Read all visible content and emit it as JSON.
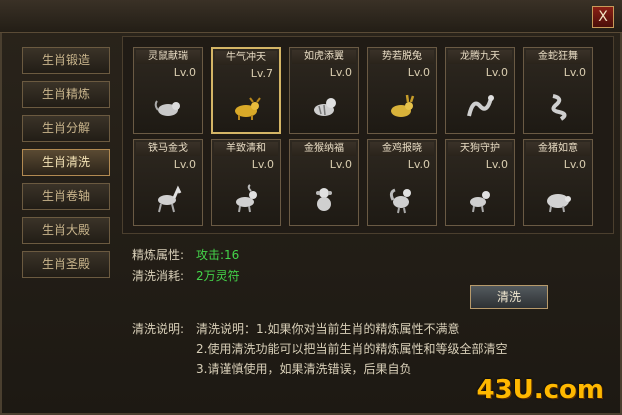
{
  "window": {
    "close_label": "X"
  },
  "sidebar": {
    "items": [
      {
        "label": "生肖锻造"
      },
      {
        "label": "生肖精炼"
      },
      {
        "label": "生肖分解"
      },
      {
        "label": "生肖清洗",
        "active": true
      },
      {
        "label": "生肖卷轴"
      },
      {
        "label": "生肖大殿"
      },
      {
        "label": "生肖圣殿"
      }
    ]
  },
  "zodiac": [
    {
      "name": "灵鼠献瑞",
      "level": "Lv.0",
      "icon": "rat-icon"
    },
    {
      "name": "牛气冲天",
      "level": "Lv.7",
      "icon": "ox-icon",
      "selected": true
    },
    {
      "name": "如虎添翼",
      "level": "Lv.0",
      "icon": "tiger-icon"
    },
    {
      "name": "势若脱兔",
      "level": "Lv.0",
      "icon": "rabbit-icon"
    },
    {
      "name": "龙腾九天",
      "level": "Lv.0",
      "icon": "dragon-icon"
    },
    {
      "name": "金蛇狂舞",
      "level": "Lv.0",
      "icon": "snake-icon"
    },
    {
      "name": "铁马金戈",
      "level": "Lv.0",
      "icon": "horse-icon"
    },
    {
      "name": "羊致清和",
      "level": "Lv.0",
      "icon": "goat-icon"
    },
    {
      "name": "金猴纳福",
      "level": "Lv.0",
      "icon": "monkey-icon"
    },
    {
      "name": "金鸡报晓",
      "level": "Lv.0",
      "icon": "rooster-icon"
    },
    {
      "name": "天狗守护",
      "level": "Lv.0",
      "icon": "dog-icon"
    },
    {
      "name": "金猪如意",
      "level": "Lv.0",
      "icon": "pig-icon"
    }
  ],
  "refine": {
    "attr_label": "精炼属性:",
    "attr_value": "攻击:16",
    "cost_label": "清洗消耗:",
    "cost_value": "2万灵符"
  },
  "wash_button": "清洗",
  "description": {
    "label": "清洗说明:",
    "line1": "清洗说明：1.如果你对当前生肖的精炼属性不满意",
    "line2": "2.使用清洗功能可以把当前生肖的精炼属性和等级全部清空",
    "line3": "3.请谨慎使用，如果清洗错误，后果自负"
  },
  "watermark": "43U.com",
  "colors": {
    "selected_border": "#d4b566",
    "value_green": "#44d44a",
    "gold": "#ffb800"
  }
}
